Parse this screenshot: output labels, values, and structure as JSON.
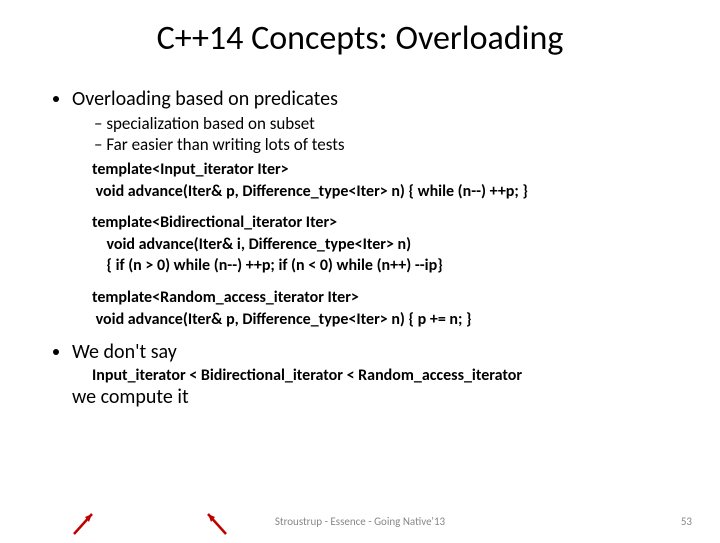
{
  "title": "C++14  Concepts: Overloading",
  "bullets": {
    "b1": "Overloading based on predicates",
    "b1s1": "specialization based on subset",
    "b1s2": "Far easier than writing lots of tests",
    "code1_l1": "template<Input_iterator Iter>",
    "code1_l2": " void advance(Iter& p, Difference_type<Iter> n) { while (n--) ++p; }",
    "code2_l1": "template<Bidirectional_iterator Iter>",
    "code2_l2": "    void advance(Iter& i, Difference_type<Iter> n)",
    "code2_l3": "    { if (n > 0) while (n--) ++p; if (n < 0) while (n++) --ip}",
    "code3_l1": "template<Random_access_iterator Iter>",
    "code3_l2": " void advance(Iter& p, Difference_type<Iter> n) { p += n; }",
    "b2": "We don't say",
    "b2_code": "Input_iterator < Bidirectional_iterator < Random_access_iterator",
    "b2_follow": "we compute it"
  },
  "footer": "Stroustrup - Essence - Going Native'13",
  "pagenum": "53"
}
